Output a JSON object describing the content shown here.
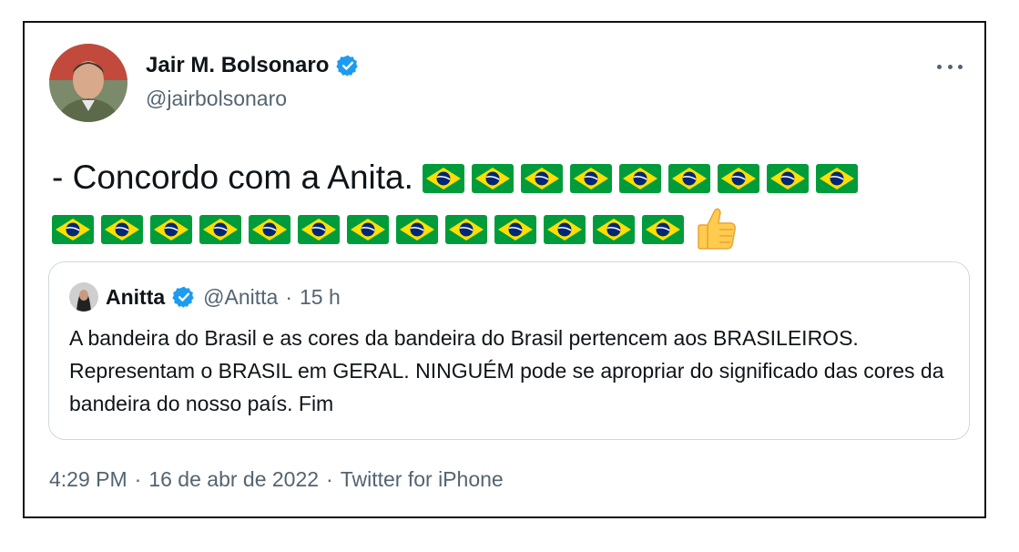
{
  "author": {
    "name": "Jair M. Bolsonaro",
    "handle": "@jairbolsonaro"
  },
  "tweet": {
    "text": "- Concordo com a Anita.",
    "flag_icon": "brazil-flag-icon",
    "flags_line1": 9,
    "flags_line2": 13,
    "thumb_icon": "thumbs-up-icon"
  },
  "quoted": {
    "name": "Anitta",
    "handle": "@Anitta",
    "separator": "·",
    "time": "15 h",
    "text": "A bandeira do Brasil e as cores da bandeira do Brasil pertencem aos BRASILEIROS. Representam o BRASIL em GERAL. NINGUÉM pode se apropriar do significado das cores da bandeira do nosso país. Fim"
  },
  "meta": {
    "time": "4:29 PM",
    "sep1": "·",
    "date": "16 de abr de 2022",
    "sep2": "·",
    "source": "Twitter for iPhone"
  },
  "colors": {
    "verified": "#1d9bf0",
    "secondary_text": "#536471",
    "flag_green": "#009c3b",
    "flag_yellow": "#ffdf00",
    "flag_blue": "#002776"
  }
}
